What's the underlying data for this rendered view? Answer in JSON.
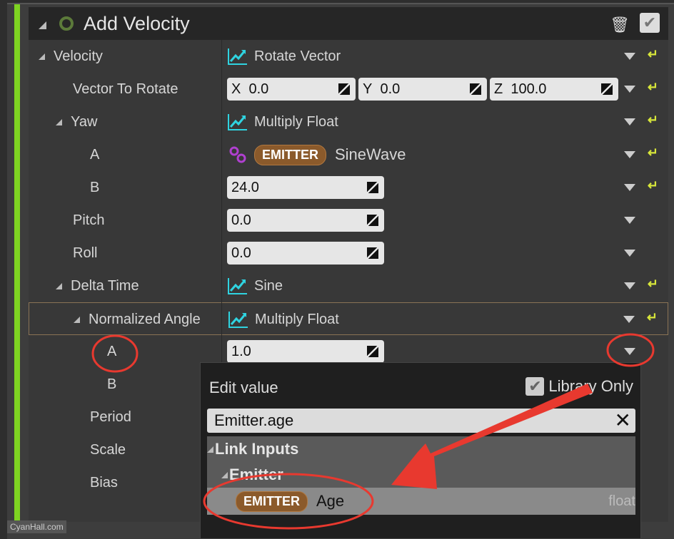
{
  "module": {
    "title": "Add Velocity"
  },
  "rows": [
    {
      "label": "Velocity",
      "indent": 0,
      "expand": true,
      "kind": "fn",
      "value": "Rotate Vector",
      "dd": true,
      "reset": true
    },
    {
      "label": "Vector To Rotate",
      "indent": 1,
      "kind": "vec",
      "x": "0.0",
      "y": "0.0",
      "z": "100.0",
      "dd": true,
      "reset": true
    },
    {
      "label": "Yaw",
      "indent": 1,
      "expand": true,
      "kind": "fn",
      "value": "Multiply Float",
      "dd": true,
      "reset": true
    },
    {
      "label": "A",
      "indent": 2,
      "kind": "link",
      "badge": "EMITTER",
      "value": "SineWave",
      "dd": true,
      "reset": true
    },
    {
      "label": "B",
      "indent": 2,
      "kind": "num",
      "value": "24.0",
      "dd": true,
      "reset": true
    },
    {
      "label": "Pitch",
      "indent": 1,
      "kind": "num",
      "value": "0.0",
      "dd": true,
      "reset": false
    },
    {
      "label": "Roll",
      "indent": 1,
      "kind": "num",
      "value": "0.0",
      "dd": true,
      "reset": false
    },
    {
      "label": "Delta Time",
      "indent": 1,
      "expand": true,
      "kind": "fn",
      "value": "Sine",
      "dd": true,
      "reset": true
    },
    {
      "label": "Normalized Angle",
      "indent": 2,
      "expand": true,
      "kind": "fn",
      "value": "Multiply Float",
      "dd": true,
      "reset": true,
      "selected": true
    },
    {
      "label": "A",
      "indent": 3,
      "kind": "num",
      "value": "1.0",
      "dd": true,
      "reset": false
    },
    {
      "label": "B",
      "indent": 3,
      "kind": "none"
    },
    {
      "label": "Period",
      "indent": 2,
      "kind": "none"
    },
    {
      "label": "Scale",
      "indent": 2,
      "kind": "none"
    },
    {
      "label": "Bias",
      "indent": 2,
      "kind": "none"
    }
  ],
  "popup": {
    "title": "Edit value",
    "library_only_label": "Library Only",
    "library_only_checked": true,
    "search_value": "Emitter.age",
    "category": "Link Inputs",
    "subcategory": "Emitter",
    "item": {
      "badge": "EMITTER",
      "name": "Age",
      "type": "float"
    }
  },
  "watermark": "CyanHall.com",
  "colors": {
    "accent_green": "#7ed321",
    "emitter_badge": "#8b5a2b",
    "annotation_red": "#e8392f",
    "reset_yellow": "#d7e63a",
    "function_icon": "#2fd3e0"
  }
}
